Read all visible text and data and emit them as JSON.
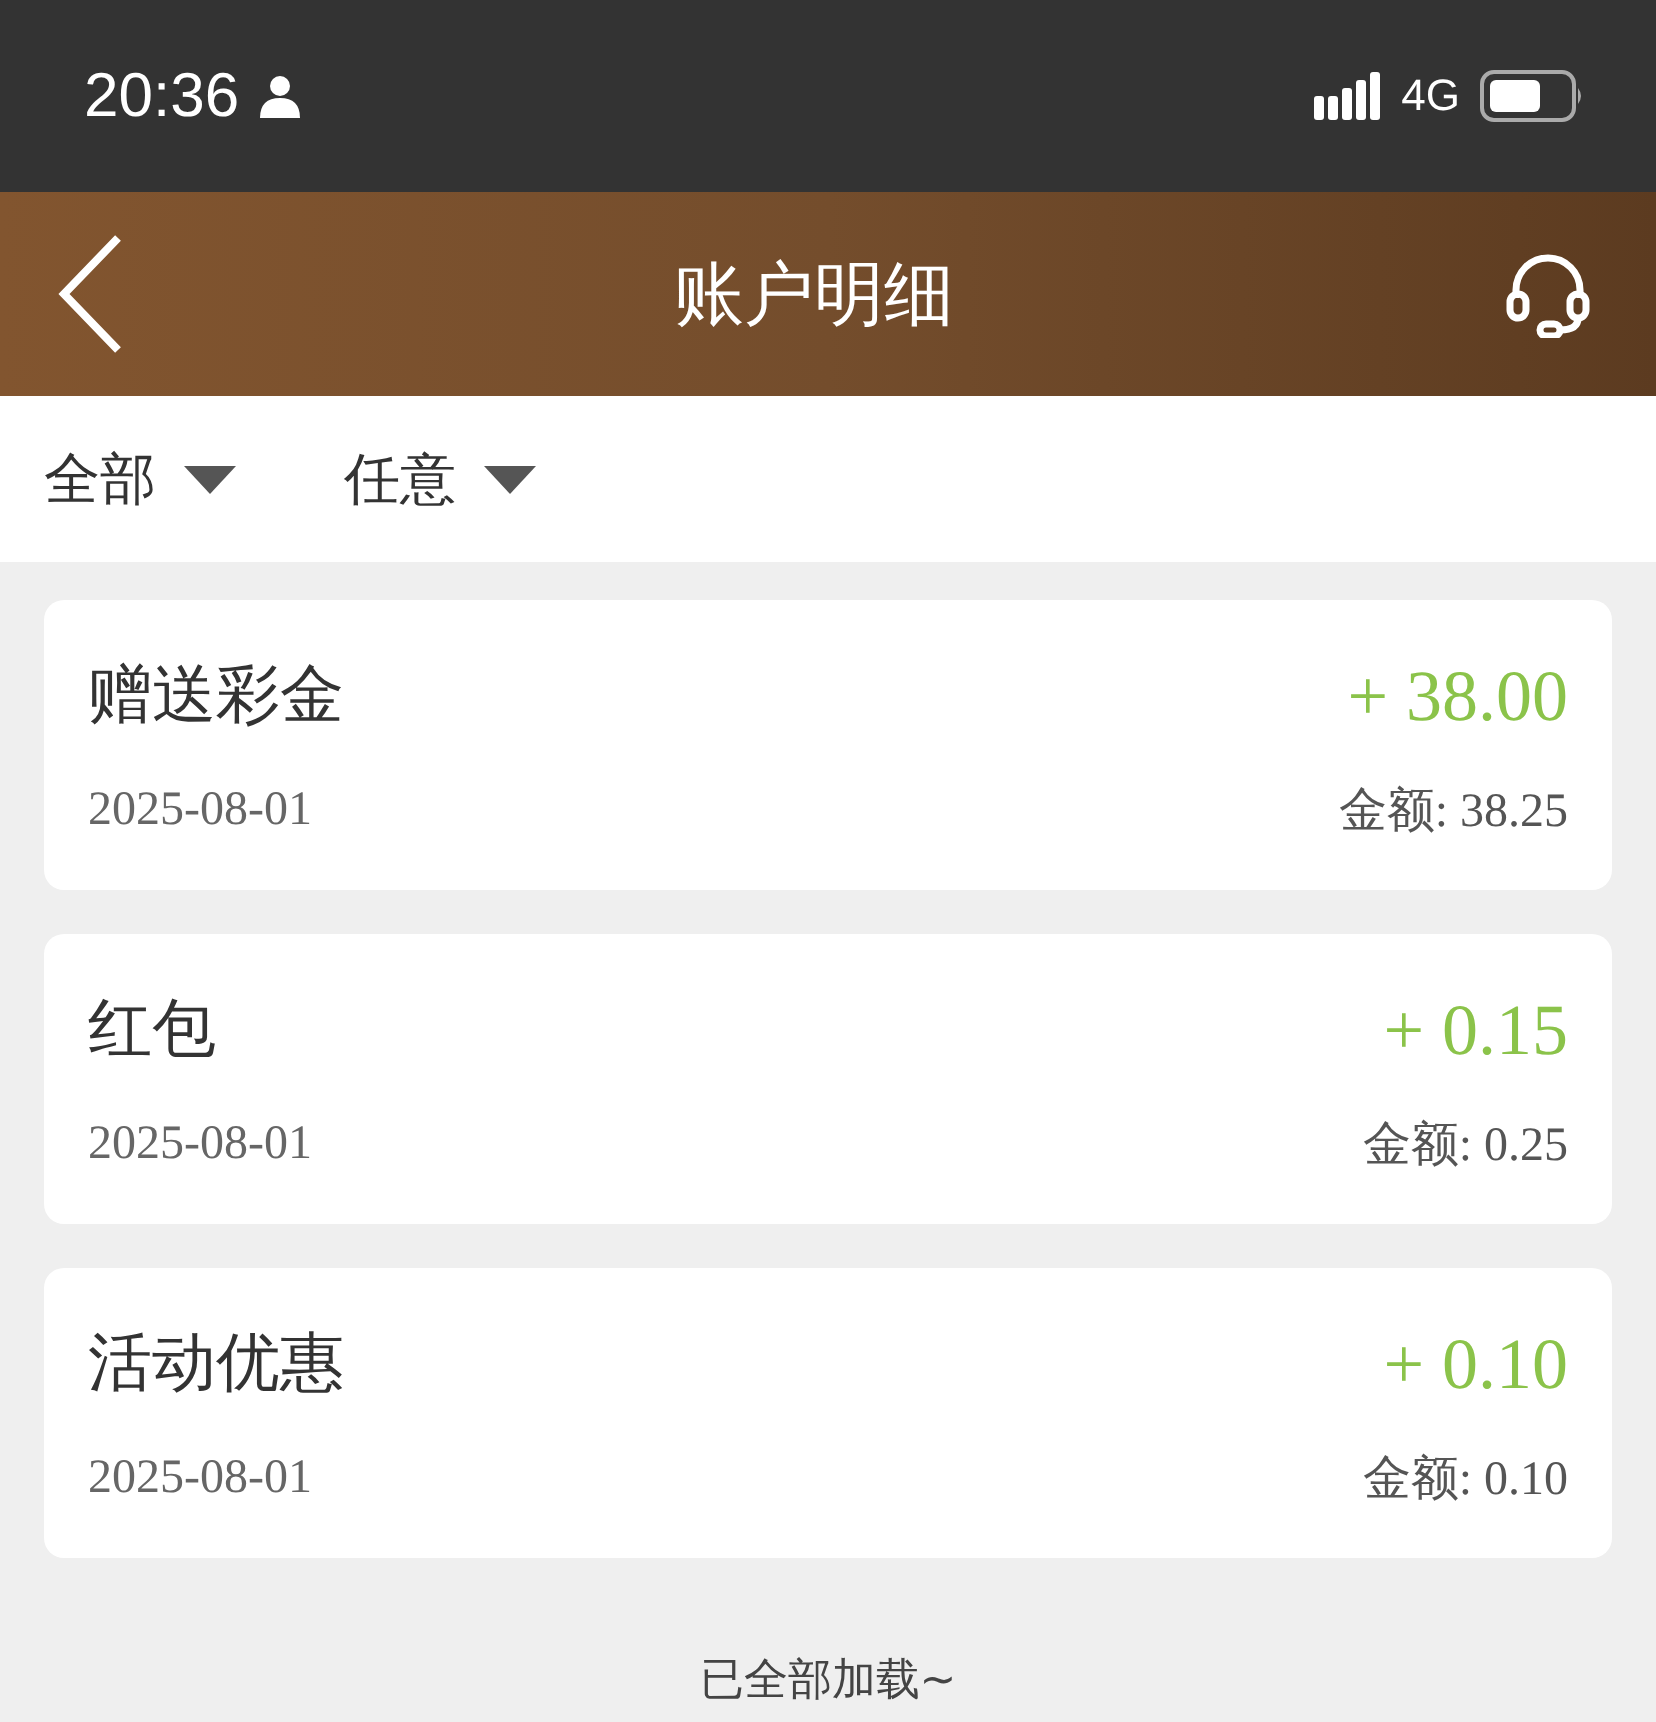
{
  "status_bar": {
    "time": "20:36",
    "network": "4G"
  },
  "header": {
    "title": "账户明细"
  },
  "filters": [
    {
      "label": "全部"
    },
    {
      "label": "任意"
    }
  ],
  "records": [
    {
      "title": "赠送彩金",
      "date": "2025-08-01",
      "amount": "+ 38.00",
      "balance": "金额: 38.25"
    },
    {
      "title": "红包",
      "date": "2025-08-01",
      "amount": "+ 0.15",
      "balance": "金额: 0.25"
    },
    {
      "title": "活动优惠",
      "date": "2025-08-01",
      "amount": "+ 0.10",
      "balance": "金额: 0.10"
    }
  ],
  "footer": "已全部加载~"
}
